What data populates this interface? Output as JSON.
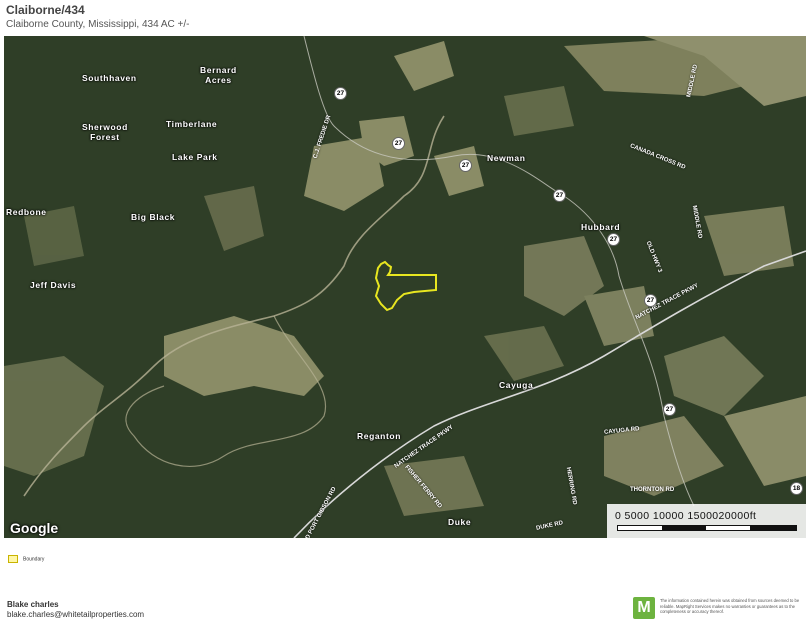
{
  "header": {
    "title": "Claiborne/434",
    "subtitle": "Claiborne County, Mississippi, 434 AC +/-"
  },
  "map": {
    "places": [
      "Southhaven",
      "Bernard\nAcres",
      "Sherwood\nForest",
      "Timberlane",
      "Lake Park",
      "Redbone",
      "Big Black",
      "Jeff Davis",
      "Newman",
      "Hubbard",
      "Cayuga",
      "Reganton",
      "Duke"
    ],
    "roads": [
      "CANADA CROSS RD",
      "OLD HWY 3",
      "NATCHEZ TRACE PKWY",
      "CAYUGA RD",
      "THORNTON RD",
      "HERRING RD",
      "FISHER FERRY RD",
      "OLD PORT GIBSON RD",
      "DUKE RD",
      "MIDDLE RD",
      "C.J. FREDIE DR"
    ],
    "highway_shields": [
      "27",
      "27",
      "27",
      "27",
      "27",
      "27",
      "27",
      "18"
    ],
    "attribution": "Google",
    "scale_bar": "0 5000 10000 1500020000ft",
    "boundary_color": "#e8e620"
  },
  "legend": {
    "boundary_label": "Boundary"
  },
  "agent": {
    "name": "Blake charles",
    "email": "blake.charles@whitetailproperties.com"
  },
  "brand": {
    "logo_letter": "M",
    "color": "#6db33f"
  },
  "disclaimer": "The information contained herein was obtained from sources deemed to be reliable. MapRight Services makes no warranties or guarantees as to the completeness or accuracy thereof."
}
